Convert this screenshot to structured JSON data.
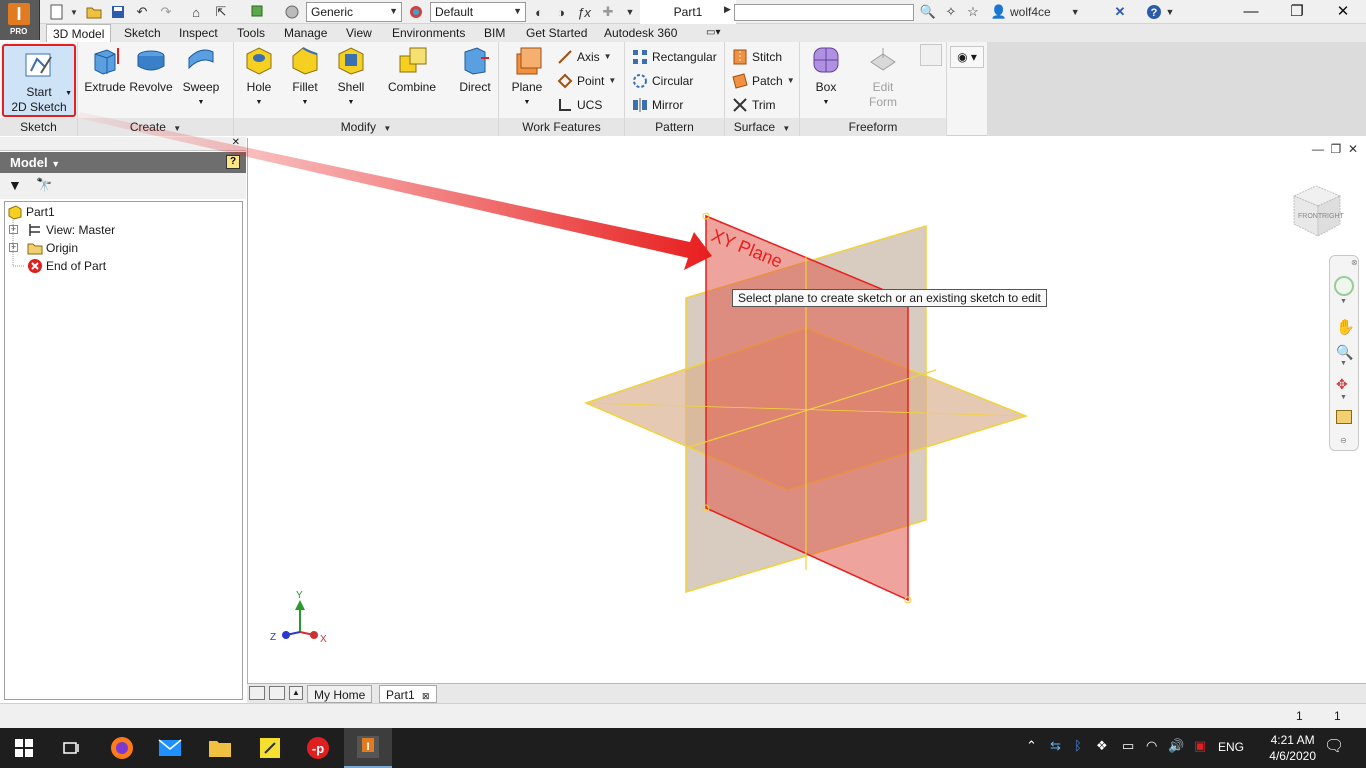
{
  "titlebar": {
    "style_value": "Generic",
    "appearance_value": "Default",
    "document_title": "Part1",
    "search_placeholder": "",
    "user_name": "wolf4ce",
    "logo_edition": "PRO"
  },
  "menu": {
    "tabs": [
      "3D Model",
      "Sketch",
      "Inspect",
      "Tools",
      "Manage",
      "View",
      "Environments",
      "BIM",
      "Get Started",
      "Autodesk 360"
    ],
    "active": "3D Model"
  },
  "ribbon": {
    "sketch_panel": {
      "label": "Sketch",
      "start_sketch_line1": "Start",
      "start_sketch_line2": "2D Sketch"
    },
    "create_panel": {
      "label": "Create",
      "extrude": "Extrude",
      "revolve": "Revolve",
      "sweep": "Sweep"
    },
    "modify_panel": {
      "label": "Modify",
      "hole": "Hole",
      "fillet": "Fillet",
      "shell": "Shell",
      "combine": "Combine",
      "direct": "Direct"
    },
    "work_features_panel": {
      "label": "Work Features",
      "plane": "Plane",
      "axis": "Axis",
      "point": "Point",
      "ucs": "UCS"
    },
    "pattern_panel": {
      "label": "Pattern",
      "rectangular": "Rectangular",
      "circular": "Circular",
      "mirror": "Mirror"
    },
    "surface_panel": {
      "label": "Surface",
      "stitch": "Stitch",
      "patch": "Patch",
      "trim": "Trim"
    },
    "freeform_panel": {
      "label": "Freeform",
      "box": "Box",
      "edit_form_line1": "Edit",
      "edit_form_line2": "Form"
    }
  },
  "browser": {
    "title": "Model",
    "nodes": [
      {
        "label": "Part1"
      },
      {
        "label": "View: Master"
      },
      {
        "label": "Origin"
      },
      {
        "label": "End of Part"
      }
    ]
  },
  "viewport": {
    "plane_label": "XY Plane",
    "tooltip": "Select plane to create sketch or an existing sketch to edit",
    "axis_x": "X",
    "axis_y": "Y",
    "axis_z": "Z",
    "viewcube_front": "FRONT",
    "viewcube_right": "RIGHT"
  },
  "doc_tabs": [
    "My Home",
    "Part1"
  ],
  "statusbar": {
    "count1": "1",
    "count2": "1"
  },
  "taskbar": {
    "language": "ENG",
    "time": "4:21 AM",
    "date": "4/6/2020"
  },
  "colors": {
    "accent_orange": "#e07b22",
    "highlight_red": "#e81e1e",
    "plane_red": "#e05a4a",
    "plane_outline": "#f2d23a"
  }
}
